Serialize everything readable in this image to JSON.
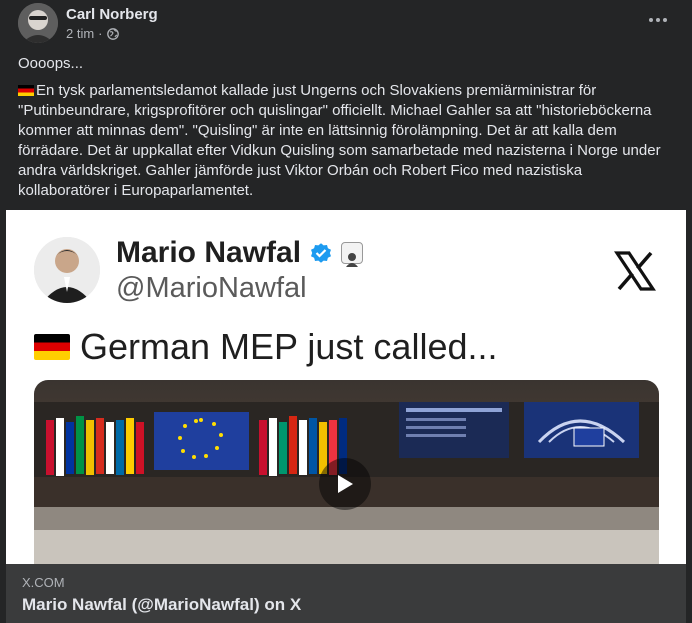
{
  "post": {
    "author": "Carl Norberg",
    "time": "2 tim",
    "separator": "·",
    "audience_icon": "globe-icon",
    "paragraph1": "Oooops...",
    "paragraph2": "En tysk parlamentsledamot kallade just Ungerns och Slovakiens premiärministrar för \"Putinbeundrare, krigsprofitörer och quislingar\" officiellt. Michael Gahler sa att \"historieböckerna kommer att minnas dem\". \"Quisling\" är inte en lättsinnig förolämpning. Det är att kalla dem förrädare. Det är uppkallat efter Vidkun Quisling som samarbetade med nazisterna i Norge under andra världskriget. Gahler jämförde just Viktor Orbán och Robert Fico med nazistiska kollaboratörer i Europaparlamentet.",
    "flag_icon": "germany-flag-icon"
  },
  "embed": {
    "name": "Mario Nawfal",
    "handle": "@MarioNawfal",
    "headline": "German MEP just called...",
    "platform_icon": "x-logo-icon"
  },
  "link": {
    "domain": "X.COM",
    "title": "Mario Nawfal (@MarioNawfal) on X"
  },
  "colors": {
    "background": "#242526",
    "text_primary": "#e4e6eb",
    "text_secondary": "#b0b3b8",
    "link_footer": "#3a3b3c",
    "verified": "#1d9bf0"
  }
}
